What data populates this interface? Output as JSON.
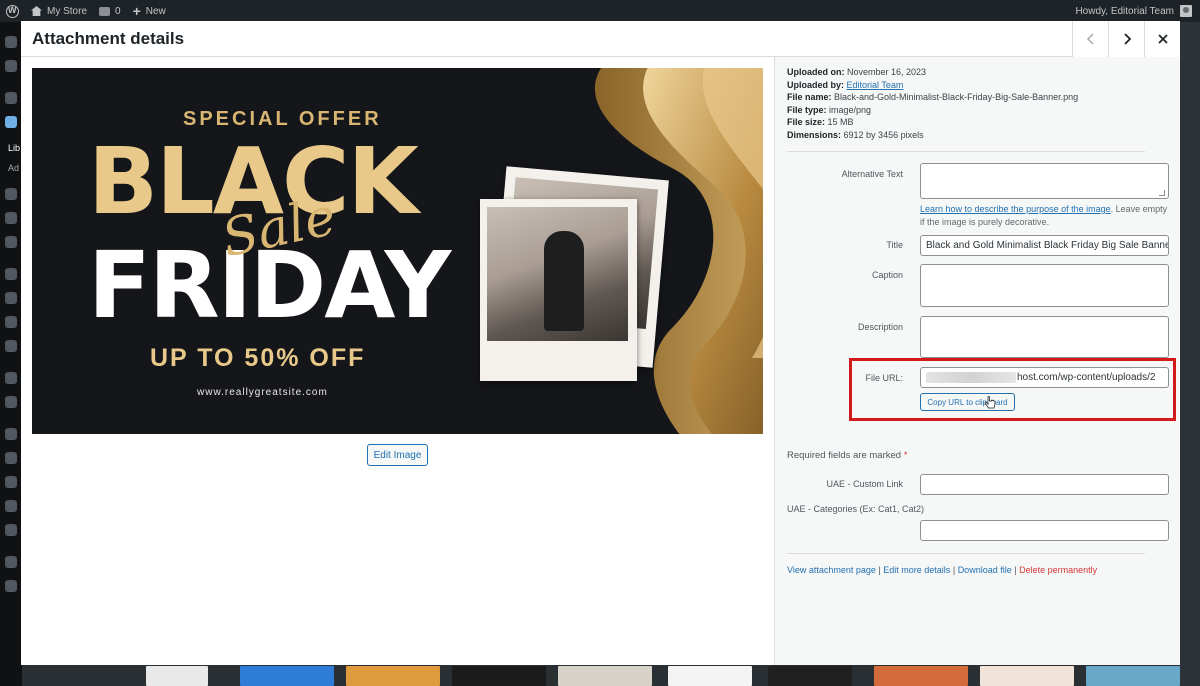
{
  "admin_bar": {
    "site_name": "My Store",
    "comments_count": "0",
    "new_label": "New",
    "greeting": "Howdy, Editorial Team"
  },
  "sidebar": {
    "partial_labels": [
      "Lib",
      "Ad"
    ]
  },
  "modal": {
    "title": "Attachment details",
    "prev_icon": "chevron-left-icon",
    "next_icon": "chevron-right-icon",
    "close_icon": "close-icon"
  },
  "image": {
    "special_offer": "SPECIAL OFFER",
    "black": "BLACK",
    "sale": "Sale",
    "friday": "FRIDAY",
    "up_to": "UP TO 50% OFF",
    "website": "www.reallygreatsite.com",
    "edit_button": "Edit Image"
  },
  "meta": {
    "uploaded_on_label": "Uploaded on:",
    "uploaded_on": "November 16, 2023",
    "uploaded_by_label": "Uploaded by:",
    "uploaded_by": "Editorial Team",
    "file_name_label": "File name:",
    "file_name": "Black-and-Gold-Minimalist-Black-Friday-Big-Sale-Banner.png",
    "file_type_label": "File type:",
    "file_type": "image/png",
    "file_size_label": "File size:",
    "file_size": "15 MB",
    "dimensions_label": "Dimensions:",
    "dimensions": "6912 by 3456 pixels"
  },
  "form": {
    "alt_text_label": "Alternative Text",
    "alt_text_value": "",
    "alt_help_link": "Learn how to describe the purpose of the image",
    "alt_help_rest": ". Leave empty if the image is purely decorative.",
    "title_label": "Title",
    "title_value": "Black and Gold Minimalist Black Friday Big Sale Banner",
    "caption_label": "Caption",
    "caption_value": "",
    "description_label": "Description",
    "description_value": "",
    "file_url_label": "File URL:",
    "file_url_visible": "host.com/wp-content/uploads/2",
    "copy_button": "Copy URL to clipboard",
    "required_text": "Required fields are marked",
    "required_mark": "*",
    "uae_link_label": "UAE - Custom Link",
    "uae_link_value": "",
    "uae_categories_label": "UAE - Categories (Ex: Cat1, Cat2)",
    "uae_categories_value": ""
  },
  "actions": {
    "view": "View attachment page",
    "edit": "Edit more details",
    "download": "Download file",
    "delete": "Delete permanently",
    "separator": "|"
  },
  "colors": {
    "accent": "#2271b1",
    "danger": "#d63638",
    "highlight": "#d31a1a"
  }
}
